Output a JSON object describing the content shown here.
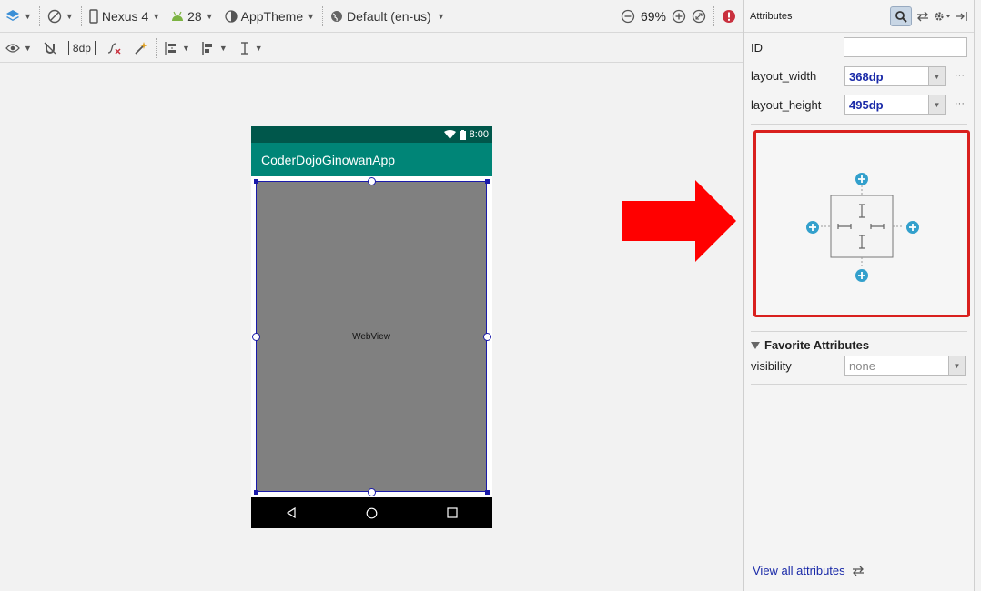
{
  "toolbar": {
    "device": "Nexus 4",
    "api_level": "28",
    "theme": "AppTheme",
    "locale": "Default (en-us)",
    "zoom": "69%",
    "margin_value": "8dp"
  },
  "device": {
    "status_time": "8:00",
    "app_title": "CoderDojoGinowanApp",
    "webview_label": "WebView"
  },
  "panel": {
    "title": "Attributes",
    "id_label": "ID",
    "id_value": "",
    "layout_width_label": "layout_width",
    "layout_width_value": "368dp",
    "layout_height_label": "layout_height",
    "layout_height_value": "495dp",
    "more_label": "···",
    "favorite_title": "Favorite Attributes",
    "visibility_label": "visibility",
    "visibility_value": "none",
    "view_all_link": "View all attributes"
  },
  "colors": {
    "accent_red": "#d9201e",
    "status_bar": "#00574b",
    "app_bar": "#008577",
    "link_blue": "#1a2aa8",
    "plus_blue": "#33a0cc"
  }
}
